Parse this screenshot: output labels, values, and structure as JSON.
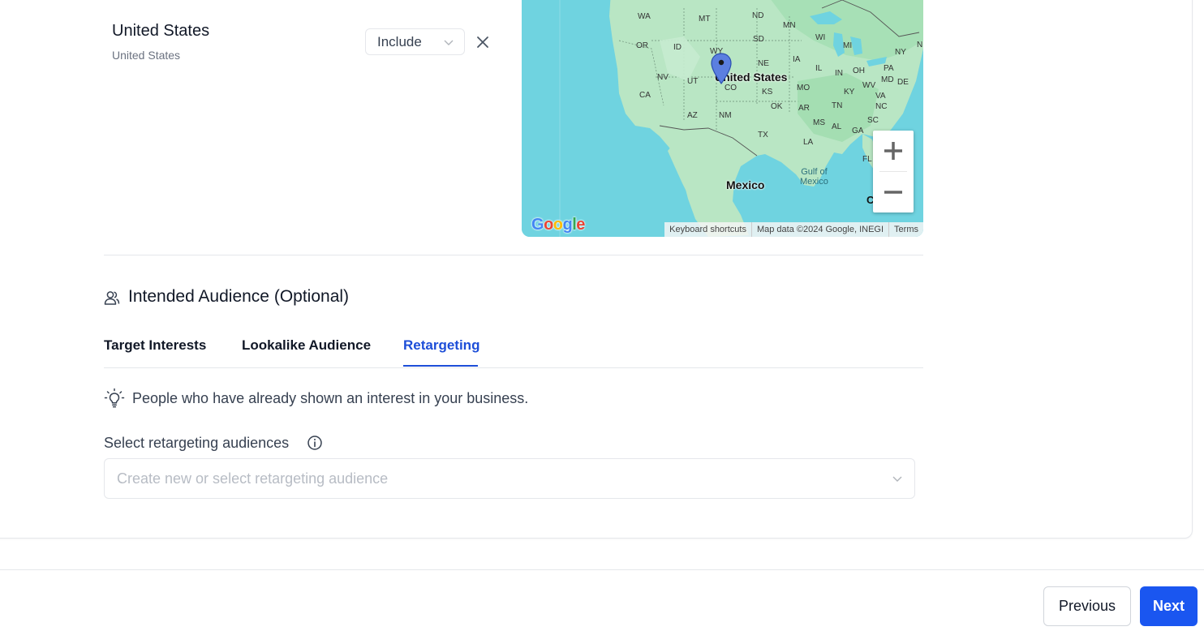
{
  "location": {
    "name": "United States",
    "subtitle": "United States",
    "mode_selected": "Include",
    "remove_icon": "close-icon"
  },
  "map": {
    "labels": {
      "states": [
        "WA",
        "MT",
        "ND",
        "MN",
        "OR",
        "ID",
        "SD",
        "WI",
        "MI",
        "NY",
        "WY",
        "NE",
        "IA",
        "IL",
        "IN",
        "OH",
        "PA",
        "NV",
        "UT",
        "MO",
        "KY",
        "WV",
        "MD",
        "DE",
        "CA",
        "CO",
        "KS",
        "TN",
        "VA",
        "NC",
        "AZ",
        "NM",
        "OK",
        "AR",
        "SC",
        "MS",
        "AL",
        "GA",
        "TX",
        "LA",
        "FL",
        "N",
        "C"
      ],
      "country_main": "United States",
      "country_south": "Mexico",
      "water": [
        "Gulf of",
        "Mexico"
      ]
    },
    "attribution": {
      "logo": "Google",
      "keyboard": "Keyboard shortcuts",
      "data": "Map data ©2024 Google, INEGI",
      "terms": "Terms"
    },
    "zoom_in_icon": "plus-icon",
    "zoom_out_icon": "minus-icon",
    "colors": {
      "water": "#6fd3e0",
      "land": "#b9e6c4",
      "land_dark": "#9fdcae"
    }
  },
  "audience": {
    "title": "Intended Audience (Optional)",
    "icon": "user-group-icon",
    "tabs": [
      {
        "label": "Target Interests",
        "active": false
      },
      {
        "label": "Lookalike Audience",
        "active": false
      },
      {
        "label": "Retargeting",
        "active": true
      }
    ],
    "hint": "People who have already shown an interest in your business.",
    "hint_icon": "lightbulb-icon",
    "select_label": "Select retargeting audiences",
    "select_placeholder": "Create new or select retargeting audience"
  },
  "footer": {
    "previous": "Previous",
    "next": "Next"
  },
  "colors": {
    "accent": "#1a56f0",
    "active_tab": "#1d4ed8",
    "border": "#e5e7eb"
  }
}
